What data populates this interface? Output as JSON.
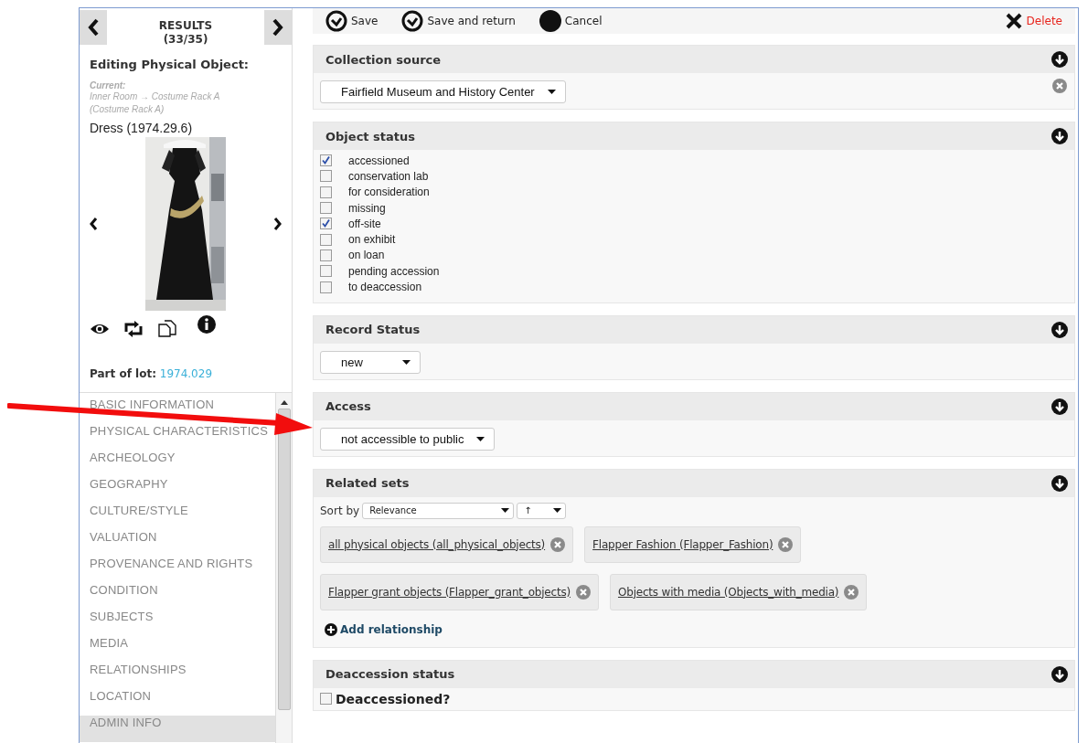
{
  "sidebar": {
    "results_title": "RESULTS",
    "results_count": "(33/35)",
    "heading": "Editing Physical Object:",
    "current_label": "Current:",
    "current_location": "Inner Room → Costume Rack A (Costume Rack A)",
    "object_title": "Dress (1974.29.6)",
    "part_of_lot_label": "Part of lot:",
    "part_of_lot_value": "1974.029",
    "nav_items": [
      {
        "label": "BASIC INFORMATION",
        "selected": false
      },
      {
        "label": "PHYSICAL CHARACTERISTICS",
        "selected": false
      },
      {
        "label": "ARCHEOLOGY",
        "selected": false
      },
      {
        "label": "GEOGRAPHY",
        "selected": false
      },
      {
        "label": "CULTURE/STYLE",
        "selected": false
      },
      {
        "label": "VALUATION",
        "selected": false
      },
      {
        "label": "PROVENANCE AND RIGHTS",
        "selected": false
      },
      {
        "label": "CONDITION",
        "selected": false
      },
      {
        "label": "SUBJECTS",
        "selected": false
      },
      {
        "label": "MEDIA",
        "selected": false
      },
      {
        "label": "RELATIONSHIPS",
        "selected": false
      },
      {
        "label": "LOCATION",
        "selected": false
      },
      {
        "label": "ADMIN INFO",
        "selected": true
      }
    ]
  },
  "toolbar": {
    "buttons": [
      {
        "label": "Save",
        "kind": "check"
      },
      {
        "label": "Save and return",
        "kind": "check"
      },
      {
        "label": "Cancel",
        "kind": "cancel"
      },
      {
        "label": "Delete",
        "kind": "delete"
      }
    ]
  },
  "sections": [
    {
      "kind": "select",
      "title": "Collection source",
      "value": "Fairfield Museum and History Center",
      "removable": true
    },
    {
      "kind": "checklist",
      "title": "Object status",
      "options": [
        {
          "label": "accessioned",
          "checked": true
        },
        {
          "label": "conservation lab",
          "checked": false
        },
        {
          "label": "for consideration",
          "checked": false
        },
        {
          "label": "missing",
          "checked": false
        },
        {
          "label": "off-site",
          "checked": true
        },
        {
          "label": "on exhibit",
          "checked": false
        },
        {
          "label": "on loan",
          "checked": false
        },
        {
          "label": "pending accession",
          "checked": false
        },
        {
          "label": "to deaccession",
          "checked": false
        }
      ]
    },
    {
      "kind": "select",
      "title": "Record Status",
      "value": "new",
      "removable": false
    },
    {
      "kind": "select",
      "title": "Access",
      "value": "not accessible to public",
      "removable": false
    },
    {
      "kind": "sets",
      "title": "Related sets",
      "sort_label": "Sort by",
      "sort_value": "Relevance",
      "order_value": "↑",
      "sets": [
        {
          "label": "all physical objects (all_physical_objects)"
        },
        {
          "label": "Flapper Fashion (Flapper_Fashion)"
        },
        {
          "label": "Flapper grant objects (Flapper_grant_objects)"
        },
        {
          "label": "Objects with media (Objects_with_media)"
        }
      ],
      "add_label": "Add relationship"
    },
    {
      "kind": "checkbox",
      "title": "Deaccession status",
      "label": "Deaccessioned?",
      "checked": false
    }
  ]
}
